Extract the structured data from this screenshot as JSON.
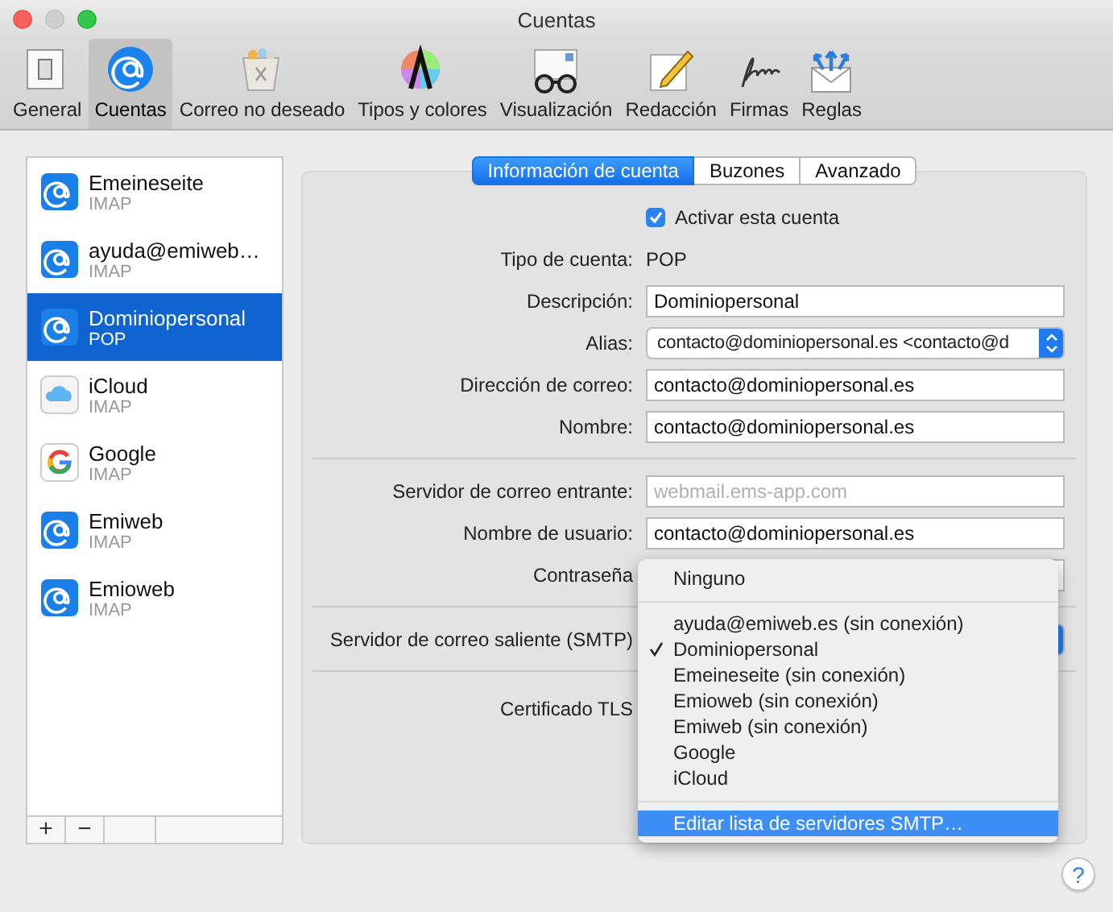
{
  "window": {
    "title": "Cuentas"
  },
  "toolbar": [
    {
      "label": "General",
      "kind": "switch",
      "selected": false
    },
    {
      "label": "Cuentas",
      "kind": "at",
      "selected": true
    },
    {
      "label": "Correo no deseado",
      "kind": "trash",
      "selected": false
    },
    {
      "label": "Tipos y colores",
      "kind": "colors",
      "selected": false
    },
    {
      "label": "Visualización",
      "kind": "glasses",
      "selected": false
    },
    {
      "label": "Redacción",
      "kind": "pad",
      "selected": false
    },
    {
      "label": "Firmas",
      "kind": "signature",
      "selected": false
    },
    {
      "label": "Reglas",
      "kind": "rules",
      "selected": false
    }
  ],
  "accounts": [
    {
      "name": "Emeineseite",
      "type": "IMAP",
      "kind": "at",
      "selected": false
    },
    {
      "name": "ayuda@emiweb…",
      "type": "IMAP",
      "kind": "at",
      "selected": false
    },
    {
      "name": "Dominiopersonal",
      "type": "POP",
      "kind": "at",
      "selected": true
    },
    {
      "name": "iCloud",
      "type": "IMAP",
      "kind": "cloud",
      "selected": false
    },
    {
      "name": "Google",
      "type": "IMAP",
      "kind": "google",
      "selected": false
    },
    {
      "name": "Emiweb",
      "type": "IMAP",
      "kind": "at",
      "selected": false
    },
    {
      "name": "Emioweb",
      "type": "IMAP",
      "kind": "at",
      "selected": false
    }
  ],
  "list_buttons": [
    "+",
    "−"
  ],
  "tabs": [
    {
      "label": "Información de cuenta",
      "selected": true
    },
    {
      "label": "Buzones",
      "selected": false
    },
    {
      "label": "Avanzado",
      "selected": false
    }
  ],
  "sections": [
    [
      {
        "kind": "checkbox",
        "label": "Activar esta cuenta",
        "checked": true
      },
      {
        "kind": "static",
        "label": "Tipo de cuenta:",
        "value": "POP"
      },
      {
        "kind": "field",
        "label": "Descripción:",
        "value": "Dominiopersonal"
      },
      {
        "kind": "popup",
        "label": "Alias:",
        "value": "contacto@dominiopersonal.es <contacto@d"
      },
      {
        "kind": "field",
        "label": "Dirección de correo:",
        "value": "contacto@dominiopersonal.es"
      },
      {
        "kind": "field",
        "label": "Nombre:",
        "value": "contacto@dominiopersonal.es"
      }
    ],
    [
      {
        "kind": "field",
        "label": "Servidor de correo entrante:",
        "placeholder": "webmail.ems-app.com"
      },
      {
        "kind": "field",
        "label": "Nombre de usuario:",
        "value": "contacto@dominiopersonal.es"
      },
      {
        "kind": "field",
        "label": "Contraseña"
      }
    ],
    [
      {
        "kind": "popup",
        "label": "Servidor de correo saliente (SMTP)"
      }
    ],
    [
      {
        "kind": "label",
        "label": "Certificado TLS"
      }
    ]
  ],
  "menu": [
    [
      {
        "label": "Ninguno",
        "checked": false,
        "selected": false
      }
    ],
    [
      {
        "label": "ayuda@emiweb.es (sin conexión)",
        "checked": false,
        "selected": false
      },
      {
        "label": "Dominiopersonal",
        "checked": true,
        "selected": false
      },
      {
        "label": "Emeineseite (sin conexión)",
        "checked": false,
        "selected": false
      },
      {
        "label": "Emioweb (sin conexión)",
        "checked": false,
        "selected": false
      },
      {
        "label": "Emiweb (sin conexión)",
        "checked": false,
        "selected": false
      },
      {
        "label": "Google",
        "checked": false,
        "selected": false
      },
      {
        "label": "iCloud",
        "checked": false,
        "selected": false
      }
    ],
    [
      {
        "label": "Editar lista de servidores SMTP…",
        "checked": false,
        "selected": true
      }
    ]
  ],
  "help": "?"
}
